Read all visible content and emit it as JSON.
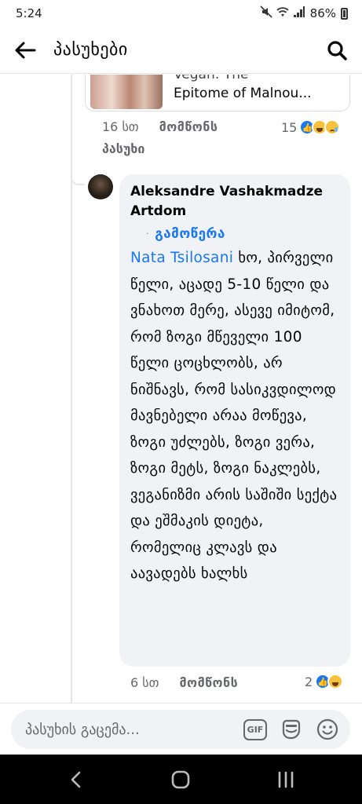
{
  "status_bar": {
    "time": "5:24",
    "battery_label": "86%",
    "icons": [
      "mute-icon",
      "wifi-icon",
      "signal-icon",
      "battery-icon"
    ]
  },
  "app_bar": {
    "title": "პასუხები",
    "back_icon": "arrow-left-icon",
    "search_icon": "search-icon"
  },
  "parent_comment": {
    "link_preview": {
      "title_line1": "Vegan: The",
      "title_line2": "Epitome of Malnou..."
    },
    "time": "16 სთ",
    "like_label": "მომწონს",
    "reply_label": "პასუხი",
    "reaction_count": "15",
    "reaction_types": [
      "like",
      "haha",
      "sad"
    ]
  },
  "reply": {
    "author": "Aleksandre Vashakmadze Artdom",
    "follow_dot": "·",
    "follow_label": "გამოწერა",
    "mention": "Nata Tsilosani",
    "body": " ხო, პირველი წელი, აცადე 5-10 წელი და ვნახოთ მერე, ასევე იმიტომ, რომ ზოგი მწეველი 100 წელი ცოცხლობს, არ ნიშნავს, რომ სასიკვდილოდ მავნებელი არაა მოწევა, ზოგი უძლებს, ზოგი ვერა, ზოგი მეტს, ზოგი ნაკლებს, ვეგანიზმი არის საშიში სექტა და ეშმაკის დიეტა, რომელიც კლავს და აავადებს ხალხს",
    "time": "6 სთ",
    "like_label": "მომწონს",
    "reaction_count": "2",
    "reaction_types": [
      "like",
      "haha"
    ]
  },
  "composer": {
    "placeholder": "პასუხის გაცემა...",
    "gif_label": "GIF",
    "icons": [
      "gif-icon",
      "sticker-icon",
      "emoji-icon"
    ]
  },
  "nav_bar": {
    "icons": [
      "nav-back-icon",
      "nav-home-icon",
      "nav-recents-icon"
    ]
  },
  "colors": {
    "accent": "#1877f2",
    "bubble": "#f0f2f5",
    "secondary_text": "#65676b"
  }
}
